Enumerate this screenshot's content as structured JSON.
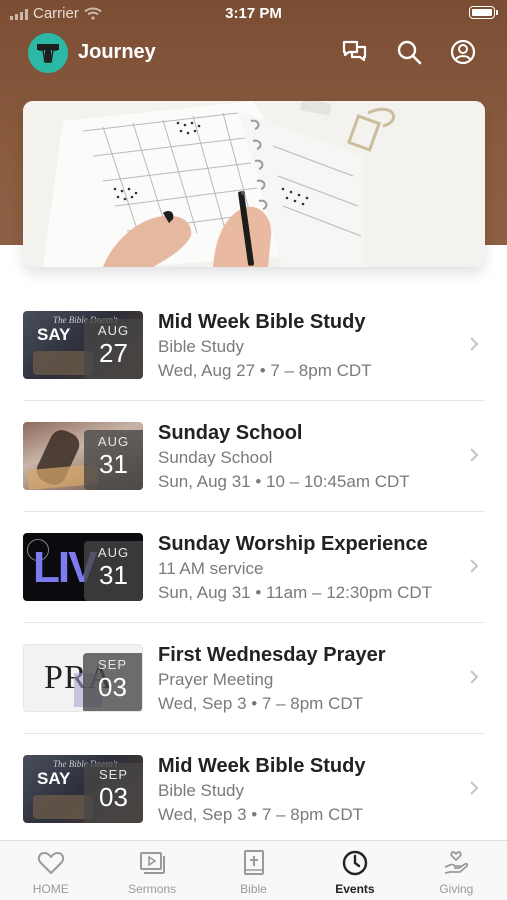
{
  "status_bar": {
    "carrier": "Carrier",
    "time": "3:17 PM"
  },
  "app": {
    "title": "Journey",
    "logo_icon": "journey-logo-icon",
    "brand_color": "#7b4d33",
    "accent_color": "#2bb9a6"
  },
  "header_actions": [
    {
      "icon": "chat-icon"
    },
    {
      "icon": "search-icon"
    },
    {
      "icon": "profile-icon"
    }
  ],
  "events": [
    {
      "title": "Mid Week Bible Study",
      "subtitle": "Bible Study",
      "time": "Wed, Aug 27 • 7 – 8pm CDT",
      "month": "AUG",
      "day": "27",
      "thumb_text": "SAY"
    },
    {
      "title": "Sunday School",
      "subtitle": "Sunday School",
      "time": "Sun, Aug 31 • 10 – 10:45am CDT",
      "month": "AUG",
      "day": "31",
      "thumb_text": ""
    },
    {
      "title": "Sunday Worship Experience",
      "subtitle": "11 AM service",
      "time": "Sun, Aug 31 • 11am – 12:30pm CDT",
      "month": "AUG",
      "day": "31",
      "thumb_text": "LIV"
    },
    {
      "title": "First Wednesday Prayer",
      "subtitle": "Prayer Meeting",
      "time": "Wed, Sep 3 • 7 – 8pm CDT",
      "month": "SEP",
      "day": "03",
      "thumb_text": "PRA"
    },
    {
      "title": "Mid Week Bible Study",
      "subtitle": "Bible Study",
      "time": "Wed, Sep 3 • 7 – 8pm CDT",
      "month": "SEP",
      "day": "03",
      "thumb_text": "SAY"
    }
  ],
  "tabs": [
    {
      "label": "HOME",
      "icon": "heart-icon",
      "active": false
    },
    {
      "label": "Sermons",
      "icon": "play-video-icon",
      "active": false
    },
    {
      "label": "Bible",
      "icon": "bible-icon",
      "active": false
    },
    {
      "label": "Events",
      "icon": "clock-icon",
      "active": true
    },
    {
      "label": "Giving",
      "icon": "giving-hand-icon",
      "active": false
    }
  ]
}
